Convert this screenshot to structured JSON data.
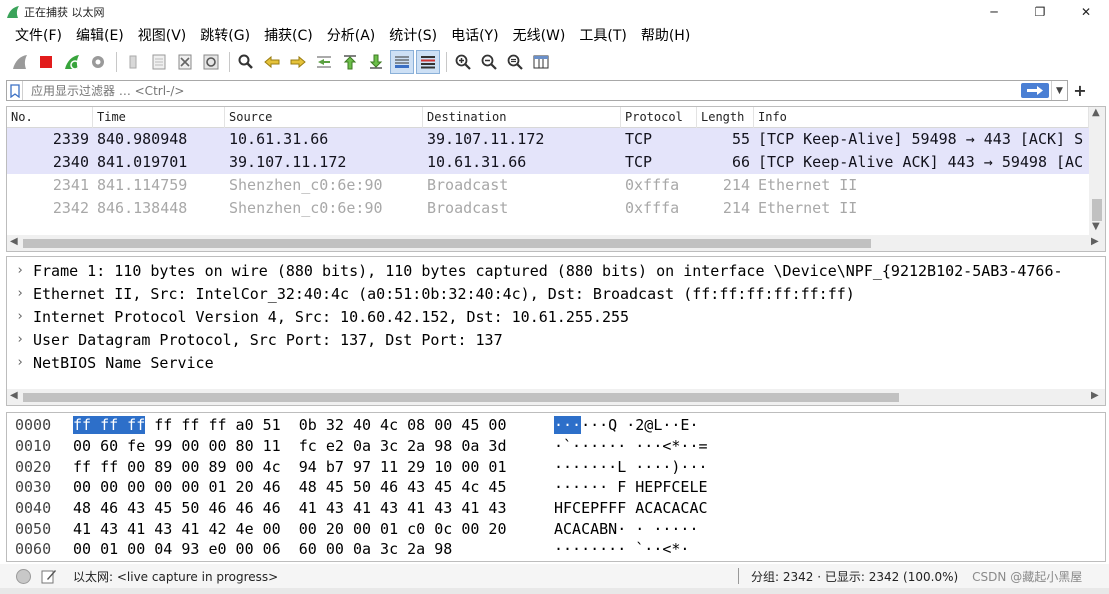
{
  "window": {
    "title": "正在捕获 以太网",
    "minimize_glyph": "─",
    "maximize_glyph": "❐",
    "close_glyph": "✕"
  },
  "menu": [
    "文件(F)",
    "编辑(E)",
    "视图(V)",
    "跳转(G)",
    "捕获(C)",
    "分析(A)",
    "统计(S)",
    "电话(Y)",
    "无线(W)",
    "工具(T)",
    "帮助(H)"
  ],
  "filter": {
    "placeholder": "应用显示过滤器 … <Ctrl-/>",
    "plus_label": "+"
  },
  "packet_list": {
    "columns": [
      "No.",
      "Time",
      "Source",
      "Destination",
      "Protocol",
      "Length",
      "Info"
    ],
    "rows": [
      {
        "no": "2339",
        "time": "840.980948",
        "source": "10.61.31.66",
        "destination": "39.107.11.172",
        "protocol": "TCP",
        "length": "55",
        "info": "[TCP Keep-Alive] 59498 → 443 [ACK] S",
        "style": "tcp"
      },
      {
        "no": "2340",
        "time": "841.019701",
        "source": "39.107.11.172",
        "destination": "10.61.31.66",
        "protocol": "TCP",
        "length": "66",
        "info": "[TCP Keep-Alive ACK] 443 → 59498 [AC",
        "style": "tcp"
      },
      {
        "no": "2341",
        "time": "841.114759",
        "source": "Shenzhen_c0:6e:90",
        "destination": "Broadcast",
        "protocol": "0xfffa",
        "length": "214",
        "info": "Ethernet II",
        "style": "bcast"
      },
      {
        "no": "2342",
        "time": "846.138448",
        "source": "Shenzhen_c0:6e:90",
        "destination": "Broadcast",
        "protocol": "0xfffa",
        "length": "214",
        "info": "Ethernet II",
        "style": "bcast"
      }
    ]
  },
  "details": [
    "Frame 1: 110 bytes on wire (880 bits), 110 bytes captured (880 bits) on interface \\Device\\NPF_{9212B102-5AB3-4766-",
    "Ethernet II, Src: IntelCor_32:40:4c (a0:51:0b:32:40:4c), Dst: Broadcast (ff:ff:ff:ff:ff:ff)",
    "Internet Protocol Version 4, Src: 10.60.42.152, Dst: 10.61.255.255",
    "User Datagram Protocol, Src Port: 137, Dst Port: 137",
    "NetBIOS Name Service"
  ],
  "bytes": [
    {
      "offset": "0000",
      "hex_hl": "ff ff ff",
      "hex_rest": " ff ff ff a0 51  0b 32 40 4c 08 00 45 00",
      "ascii_hl": "···",
      "ascii_rest": "···Q ·2@L··E·"
    },
    {
      "offset": "0010",
      "hex_hl": "",
      "hex_rest": "00 60 fe 99 00 00 80 11  fc e2 0a 3c 2a 98 0a 3d",
      "ascii_hl": "",
      "ascii_rest": "·`······ ···<*··="
    },
    {
      "offset": "0020",
      "hex_hl": "",
      "hex_rest": "ff ff 00 89 00 89 00 4c  94 b7 97 11 29 10 00 01",
      "ascii_hl": "",
      "ascii_rest": "·······L ····)···"
    },
    {
      "offset": "0030",
      "hex_hl": "",
      "hex_rest": "00 00 00 00 00 01 20 46  48 45 50 46 43 45 4c 45",
      "ascii_hl": "",
      "ascii_rest": "······ F HEPFCELE"
    },
    {
      "offset": "0040",
      "hex_hl": "",
      "hex_rest": "48 46 43 45 50 46 46 46  41 43 41 43 41 43 41 43",
      "ascii_hl": "",
      "ascii_rest": "HFCEPFFF ACACACAC"
    },
    {
      "offset": "0050",
      "hex_hl": "",
      "hex_rest": "41 43 41 43 41 42 4e 00  00 20 00 01 c0 0c 00 20",
      "ascii_hl": "",
      "ascii_rest": "ACACABN· · ·····"
    },
    {
      "offset": "0060",
      "hex_hl": "",
      "hex_rest": "00 01 00 04 93 e0 00 06  60 00 0a 3c 2a 98",
      "ascii_hl": "",
      "ascii_rest": "········ `··<*·"
    }
  ],
  "status": {
    "left_text": "以太网: <live capture in progress>",
    "packets_text": "分组: 2342 · 已显示: 2342 (100.0%)",
    "watermark": "CSDN @藏起小黑屋"
  }
}
